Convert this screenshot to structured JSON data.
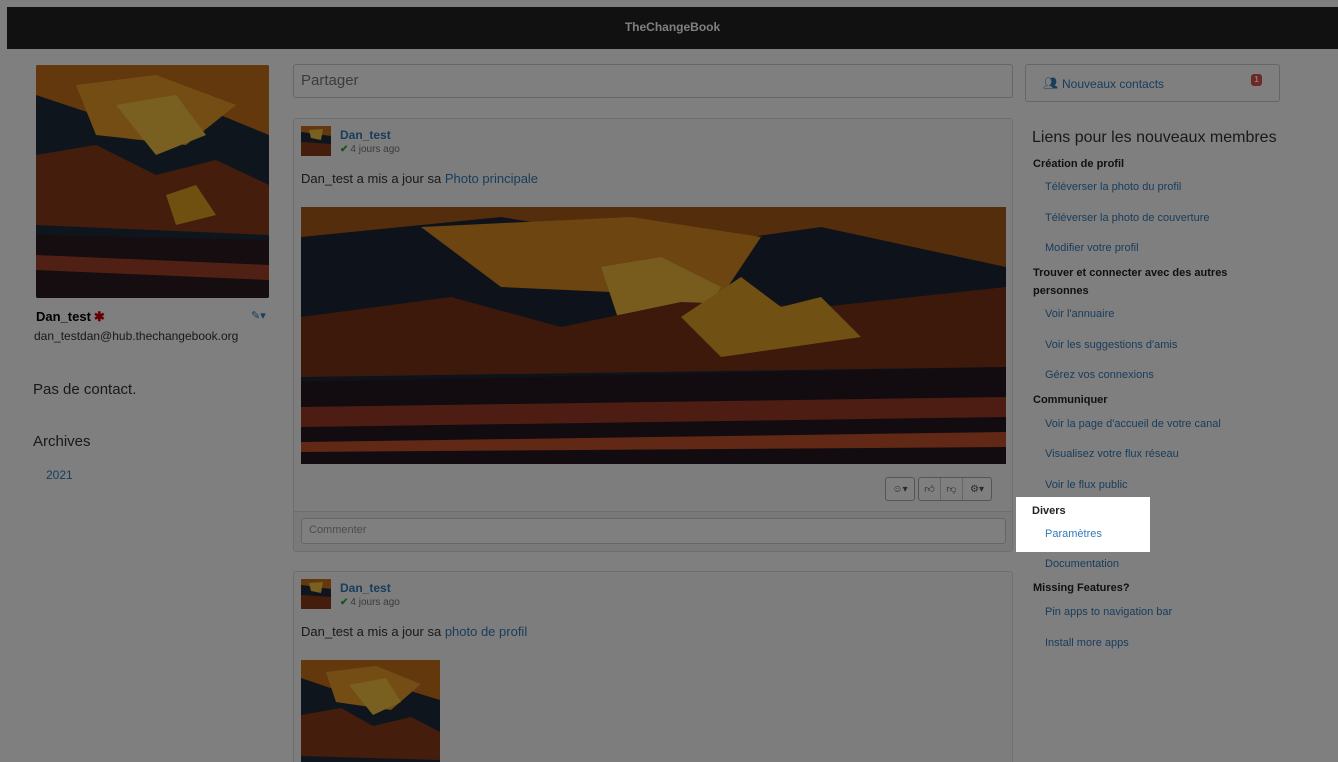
{
  "navbar": {
    "brand": "TheChangeBook"
  },
  "profile": {
    "name": "Dan_test",
    "address": "dan_testdan@hub.thechangebook.org",
    "no_contact": "Pas de contact.",
    "archives_title": "Archives",
    "archive_years": [
      "2021"
    ]
  },
  "share": {
    "placeholder": "Partager"
  },
  "posts": [
    {
      "author": "Dan_test",
      "ago": "4 jours ago",
      "text_prefix": "Dan_test a mis a jour sa",
      "link": "Photo principale",
      "comment_placeholder": "Commenter"
    },
    {
      "author": "Dan_test",
      "ago": "4 jours ago",
      "text_prefix": "Dan_test a mis a jour sa",
      "link": "photo de profil"
    }
  ],
  "contacts": {
    "label": "Nouveaux contacts",
    "badge": "1"
  },
  "new_member_links": {
    "title": "Liens pour les nouveaux membres",
    "sections": [
      {
        "title": "Création de profil",
        "links": [
          "Téléverser la photo du profil",
          "Téléverser la photo de couverture",
          "Modifier votre profil"
        ]
      },
      {
        "title": "Trouver et connecter avec des autres personnes",
        "links": [
          "Voir l'annuaire",
          "Voir les suggestions d'amis",
          "Gérez vos connexions"
        ]
      },
      {
        "title": "Communiquer",
        "links": [
          "Voir la page d'accueil de votre canal",
          "Visualisez votre flux réseau",
          "Voir le flux public"
        ]
      },
      {
        "title": "Divers",
        "links": [
          "Paramètres",
          "Documentation"
        ]
      },
      {
        "title": "Missing Features?",
        "links": [
          "Pin apps to navigation bar",
          "Install more apps"
        ]
      }
    ]
  },
  "icons": {
    "edit": "pencil-icon",
    "contacts": "users-icon",
    "verified": "check-icon",
    "emoji": "smiley-icon",
    "like": "thumbs-up-icon",
    "dislike": "thumbs-down-icon",
    "settings": "gear-icon"
  }
}
